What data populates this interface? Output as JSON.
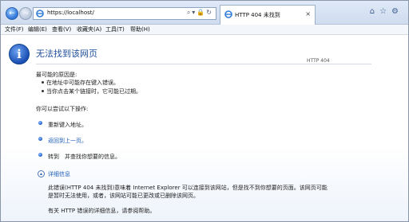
{
  "tab": {
    "title": "HTTP 404 未找到"
  },
  "address": {
    "url": "https://localhost/"
  },
  "menu": [
    "文件(F)",
    "编辑(E)",
    "查看(V)",
    "收藏夹(A)",
    "工具(T)",
    "帮助(H)"
  ],
  "page": {
    "title": "无法找到该网页",
    "status_code": "HTTP 404",
    "causes_heading": "最可能的原因是:",
    "causes": [
      "在地址中可能存在键入错误。",
      "当你点击某个链接时，它可能已过期。"
    ],
    "actions_heading": "你可以尝试以下操作:",
    "action_retype": "重新键入地址。",
    "action_back": "返回到上一页。",
    "action_goto_prefix": "转到",
    "action_goto_suffix": "并查找你想要的信息。",
    "details_label": "详细信息",
    "details_line1": "此错误(HTTP 404 未找到)意味着 Internet Explorer 可以连接到该网站，但是找不到你想要的页面。该网页可能",
    "details_line2": "是暂时无法使用，或者，该网站可能已更改或已删除该网页。",
    "help_line": "有关 HTTP 错误的详细信息，请参阅帮助。"
  },
  "icons": {
    "back": "back-arrow-icon",
    "forward": "forward-arrow-icon",
    "info": "info-icon",
    "expand": "expand-icon"
  },
  "colors": {
    "title": "#1f4d9a",
    "link": "#1f5fb8"
  }
}
